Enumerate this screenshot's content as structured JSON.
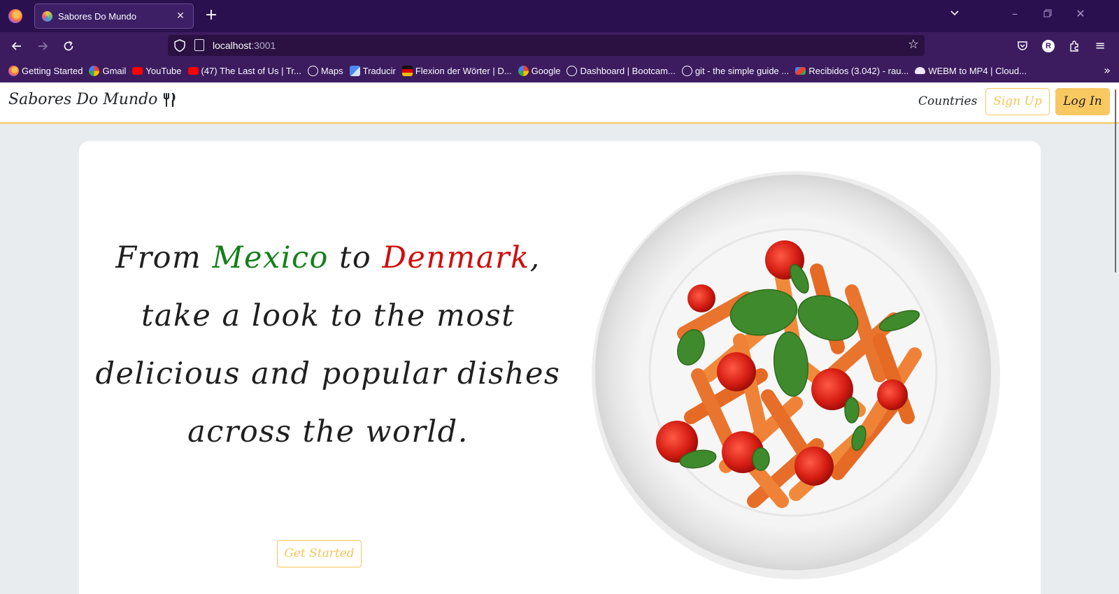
{
  "browser": {
    "tab_title": "Sabores Do Mundo",
    "url_host": "localhost",
    "url_port": ":3001",
    "bookmarks": [
      {
        "label": "Getting Started",
        "icon": "firefox-icon",
        "color": "#ff7139"
      },
      {
        "label": "Gmail",
        "icon": "google-icon",
        "color": "#4285f4"
      },
      {
        "label": "YouTube",
        "icon": "youtube-icon",
        "color": "#ff0000"
      },
      {
        "label": "(47) The Last of Us | Tr...",
        "icon": "youtube-icon",
        "color": "#ff0000"
      },
      {
        "label": "Maps",
        "icon": "globe-icon",
        "color": "#fbfbfe"
      },
      {
        "label": "Traducir",
        "icon": "google-translate-icon",
        "color": "#4a8af4"
      },
      {
        "label": "Flexion der Wörter | D...",
        "icon": "flag-icon",
        "color": "#e8c000"
      },
      {
        "label": "Google",
        "icon": "google-icon",
        "color": "#4285f4"
      },
      {
        "label": "Dashboard | Bootcam...",
        "icon": "globe-icon",
        "color": "#fbfbfe"
      },
      {
        "label": "git - the simple guide ...",
        "icon": "globe-icon",
        "color": "#fbfbfe"
      },
      {
        "label": "Recibidos (3.042) - rau...",
        "icon": "gmail-icon",
        "color": "#ea4335"
      },
      {
        "label": "WEBM to MP4 | Cloud...",
        "icon": "cloud-icon",
        "color": "#f0e6ff"
      }
    ]
  },
  "site": {
    "brand": "Sabores Do Mundo",
    "nav": {
      "countries": "Countries",
      "signup": "Sign Up",
      "login": "Log In"
    },
    "hero": {
      "line1_a": "From ",
      "line1_mexico": "Mexico",
      "line1_b": " to ",
      "line1_denmark": "Denmark",
      "line1_c": ",",
      "line2": "take a look to the most",
      "line3": "delicious and popular dishes",
      "line4": "across the world.",
      "cta": "Get Started"
    }
  },
  "colors": {
    "accent": "#f7c55a",
    "mexico": "#13801a",
    "denmark": "#cf0d0d"
  }
}
